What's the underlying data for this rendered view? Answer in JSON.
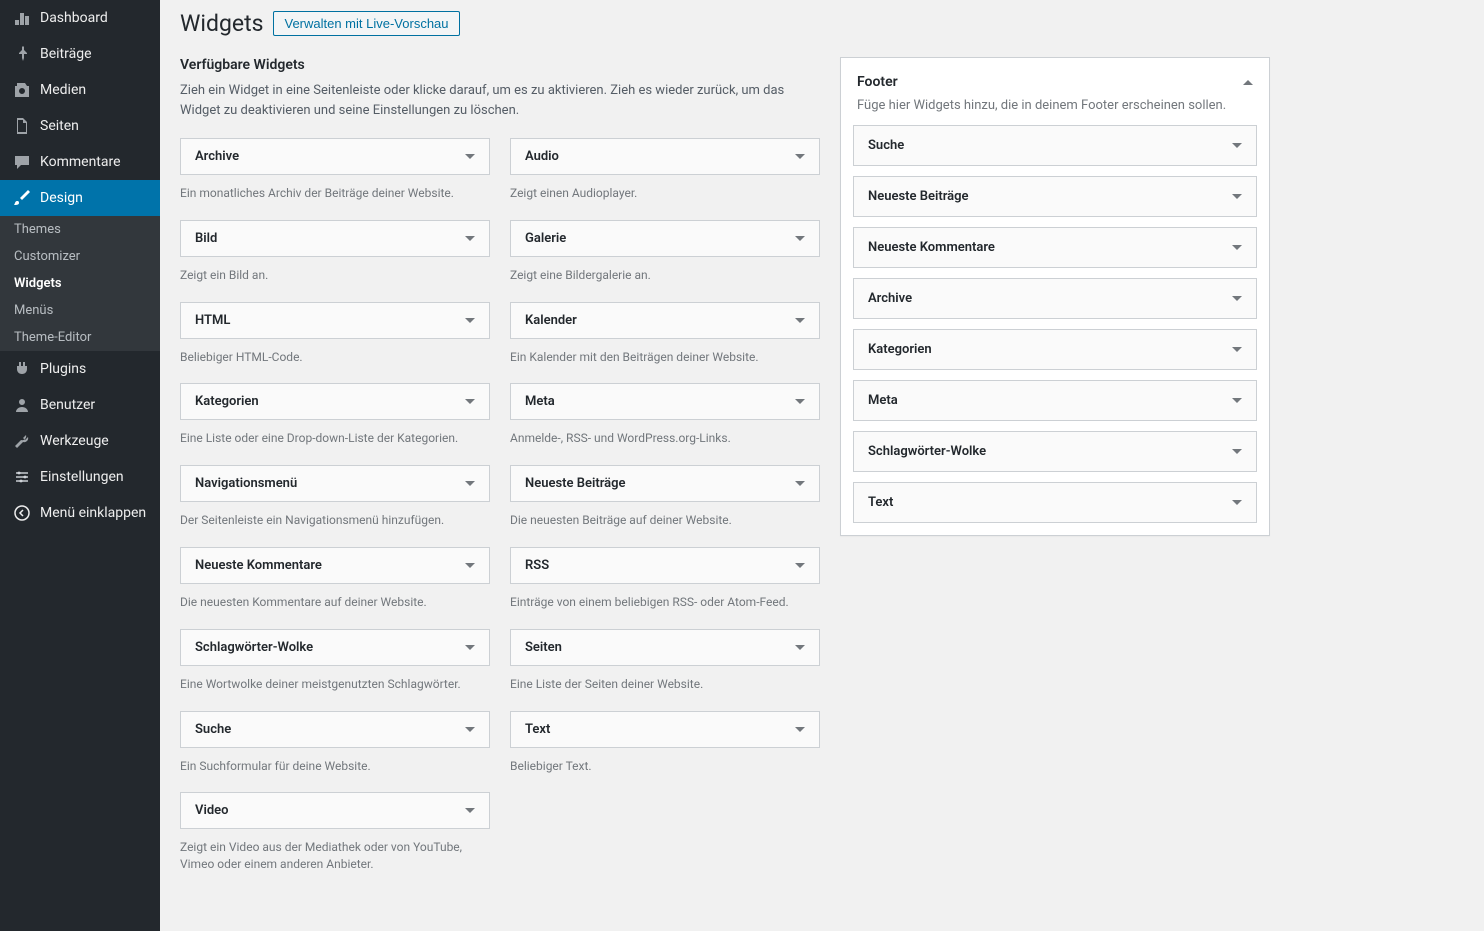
{
  "sidebar": {
    "items": [
      {
        "icon": "dashboard",
        "label": "Dashboard"
      },
      {
        "icon": "pin",
        "label": "Beiträge"
      },
      {
        "icon": "media",
        "label": "Medien"
      },
      {
        "icon": "pages",
        "label": "Seiten"
      },
      {
        "icon": "comments",
        "label": "Kommentare"
      },
      {
        "icon": "brush",
        "label": "Design",
        "active": true
      },
      {
        "icon": "plugin",
        "label": "Plugins"
      },
      {
        "icon": "users",
        "label": "Benutzer"
      },
      {
        "icon": "tools",
        "label": "Werkzeuge"
      },
      {
        "icon": "settings",
        "label": "Einstellungen"
      },
      {
        "icon": "collapse",
        "label": "Menü einklappen"
      }
    ],
    "submenu": [
      {
        "label": "Themes"
      },
      {
        "label": "Customizer"
      },
      {
        "label": "Widgets",
        "current": true
      },
      {
        "label": "Menüs"
      },
      {
        "label": "Theme-Editor"
      }
    ]
  },
  "header": {
    "title": "Widgets",
    "button": "Verwalten mit Live-Vorschau"
  },
  "available": {
    "title": "Verfügbare Widgets",
    "desc": "Zieh ein Widget in eine Seitenleiste oder klicke darauf, um es zu aktivieren. Zieh es wieder zurück, um das Widget zu deaktivieren und seine Einstellungen zu löschen.",
    "widgets": [
      {
        "title": "Archive",
        "desc": "Ein monatliches Archiv der Beiträge deiner Website."
      },
      {
        "title": "Audio",
        "desc": "Zeigt einen Audioplayer."
      },
      {
        "title": "Bild",
        "desc": "Zeigt ein Bild an."
      },
      {
        "title": "Galerie",
        "desc": "Zeigt eine Bildergalerie an."
      },
      {
        "title": "HTML",
        "desc": "Beliebiger HTML-Code."
      },
      {
        "title": "Kalender",
        "desc": "Ein Kalender mit den Beiträgen deiner Website."
      },
      {
        "title": "Kategorien",
        "desc": "Eine Liste oder eine Drop-down-Liste der Kategorien."
      },
      {
        "title": "Meta",
        "desc": "Anmelde-, RSS- und WordPress.org-Links."
      },
      {
        "title": "Navigationsmenü",
        "desc": "Der Seitenleiste ein Navigationsmenü hinzufügen."
      },
      {
        "title": "Neueste Beiträge",
        "desc": "Die neuesten Beiträge auf deiner Website."
      },
      {
        "title": "Neueste Kommentare",
        "desc": "Die neuesten Kommentare auf deiner Website."
      },
      {
        "title": "RSS",
        "desc": "Einträge von einem beliebigen RSS- oder Atom-Feed."
      },
      {
        "title": "Schlagwörter-Wolke",
        "desc": "Eine Wortwolke deiner meistgenutzten Schlagwörter."
      },
      {
        "title": "Seiten",
        "desc": "Eine Liste der Seiten deiner Website."
      },
      {
        "title": "Suche",
        "desc": "Ein Suchformular für deine Website."
      },
      {
        "title": "Text",
        "desc": "Beliebiger Text."
      },
      {
        "title": "Video",
        "desc": "Zeigt ein Video aus der Mediathek oder von YouTube, Vimeo oder einem anderen Anbieter."
      }
    ]
  },
  "area": {
    "title": "Footer",
    "desc": "Füge hier Widgets hinzu, die in deinem Footer erscheinen sollen.",
    "items": [
      {
        "title": "Suche"
      },
      {
        "title": "Neueste Beiträge"
      },
      {
        "title": "Neueste Kommentare"
      },
      {
        "title": "Archive"
      },
      {
        "title": "Kategorien"
      },
      {
        "title": "Meta"
      },
      {
        "title": "Schlagwörter-Wolke"
      },
      {
        "title": "Text"
      }
    ]
  }
}
